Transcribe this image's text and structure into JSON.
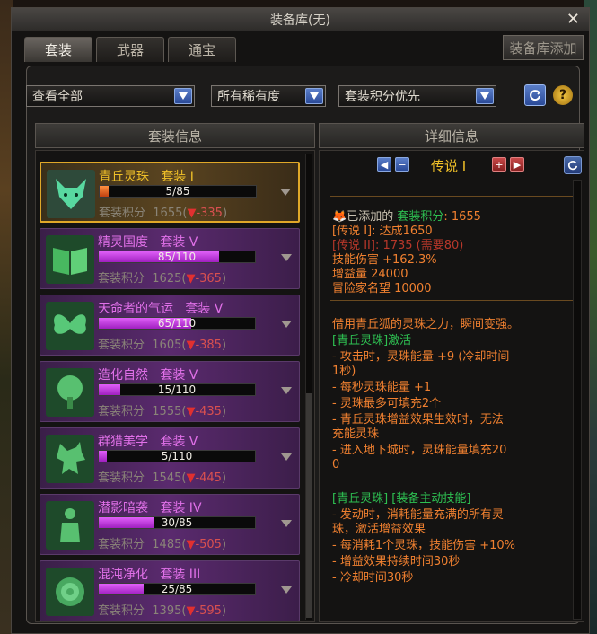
{
  "window": {
    "title": "装备库(无)"
  },
  "tabs": [
    {
      "label": "套装"
    },
    {
      "label": "武器"
    },
    {
      "label": "通宝"
    }
  ],
  "add_button": "装备库添加",
  "filters": {
    "view": "查看全部",
    "rarity": "所有稀有度",
    "sort": "套装积分优先"
  },
  "headers": {
    "left": "套装信息",
    "right": "详细信息"
  },
  "sets": [
    {
      "name": "青丘灵珠",
      "type": "套装 I",
      "progress": "5/85",
      "fill": 0.06,
      "score_label": "套装积分",
      "score": "1655",
      "down": "-335",
      "icon": "fox-icon",
      "selected": true
    },
    {
      "name": "精灵国度",
      "type": "套装 V",
      "progress": "85/110",
      "fill": 0.77,
      "score_label": "套装积分",
      "score": "1625",
      "down": "-365",
      "icon": "book-icon"
    },
    {
      "name": "天命者的气运",
      "type": "套装 V",
      "progress": "65/110",
      "fill": 0.59,
      "score_label": "套装积分",
      "score": "1605",
      "down": "-385",
      "icon": "butterfly-icon"
    },
    {
      "name": "造化自然",
      "type": "套装 V",
      "progress": "15/110",
      "fill": 0.14,
      "score_label": "套装积分",
      "score": "1555",
      "down": "-435",
      "icon": "tree-icon"
    },
    {
      "name": "群猎美学",
      "type": "套装 V",
      "progress": "5/110",
      "fill": 0.05,
      "score_label": "套装积分",
      "score": "1545",
      "down": "-445",
      "icon": "wolf-icon"
    },
    {
      "name": "潜影暗袭",
      "type": "套装 IV",
      "progress": "30/85",
      "fill": 0.35,
      "score_label": "套装积分",
      "score": "1485",
      "down": "-505",
      "icon": "figure-icon"
    },
    {
      "name": "混沌净化",
      "type": "套装 III",
      "progress": "25/85",
      "fill": 0.29,
      "score_label": "套装积分",
      "score": "1395",
      "down": "-595",
      "icon": "rose-icon"
    }
  ],
  "detail": {
    "tier": "传说 I",
    "added_prefix": "已添加的",
    "score_label": "套装积分",
    "score_value": ": 1655",
    "lines": [
      "[传说 I]: 达成1650",
      "[传说 II]: 1735 (需要80)",
      "技能伤害 +162.3%",
      "增益量 24000",
      "冒险家名望 10000"
    ],
    "desc": [
      "借用青丘狐的灵珠之力，瞬间变强。",
      "[青丘灵珠]激活",
      "- 攻击时，灵珠能量 +9 (冷却时间",
      "1秒)",
      "- 每秒灵珠能量 +1",
      "- 灵珠最多可填充2个",
      "- 青丘灵珠增益效果生效时，无法",
      "充能灵珠",
      "- 进入地下城时，灵珠能量填充20",
      "0",
      "[青丘灵珠] [装备主动技能]",
      "- 发动时，消耗能量充满的所有灵",
      "珠，激活增益效果",
      "- 每消耗1个灵珠，技能伤害 +10%",
      "- 增益效果持续时间30秒",
      "- 冷却时间30秒"
    ]
  },
  "colors": {
    "gold": "#f0c028",
    "purple_name": "#e070e8",
    "down_red": "#e03030",
    "green": "#2ec052"
  }
}
